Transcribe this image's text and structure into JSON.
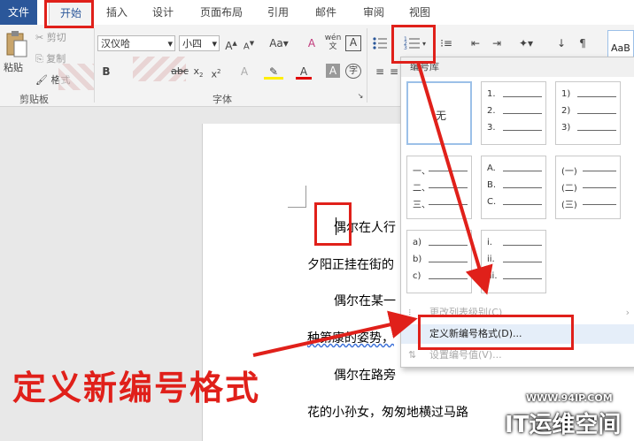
{
  "menubar": {
    "tabs": [
      "文件",
      "开始",
      "插入",
      "设计",
      "页面布局",
      "引用",
      "邮件",
      "审阅",
      "视图"
    ]
  },
  "clipboard": {
    "paste": "粘贴",
    "cut": "剪切",
    "copy": "复制",
    "format_painter": "格式",
    "group_label": "剪贴板"
  },
  "font": {
    "name": "汉仪哈",
    "size": "小四",
    "group_label": "字体",
    "wen": "wén"
  },
  "styles": {
    "preview": "AaB"
  },
  "numbering_dropdown": {
    "library_title": "编号库",
    "none_label": "无",
    "cells": [
      [
        "1.",
        "2.",
        "3."
      ],
      [
        "1)",
        "2)",
        "3)"
      ],
      [
        "一、",
        "二、",
        "三、"
      ],
      [
        "A.",
        "B.",
        "C."
      ],
      [
        "(一)",
        "(二)",
        "(三)"
      ],
      [
        "a)",
        "b)",
        "c)"
      ],
      [
        "i.",
        "ii.",
        "iii."
      ]
    ],
    "change_level": "更改列表级别(C)",
    "define_new": "定义新编号格式(D)...",
    "set_value": "设置编号值(V)..."
  },
  "document": {
    "lines": [
      "偶尔在人行",
      "夕阳正挂在街的",
      "偶尔在某一",
      "种第康的姿势，",
      "偶尔在路旁",
      "花的小孙女，匆匆地横过马路"
    ]
  },
  "annotation": {
    "text": "定义新编号格式"
  },
  "watermark": {
    "url": "WWW.94IP.COM",
    "brand": "IT运维空间"
  },
  "colors": {
    "accent": "#2b579a",
    "annotation_red": "#e0201a"
  }
}
